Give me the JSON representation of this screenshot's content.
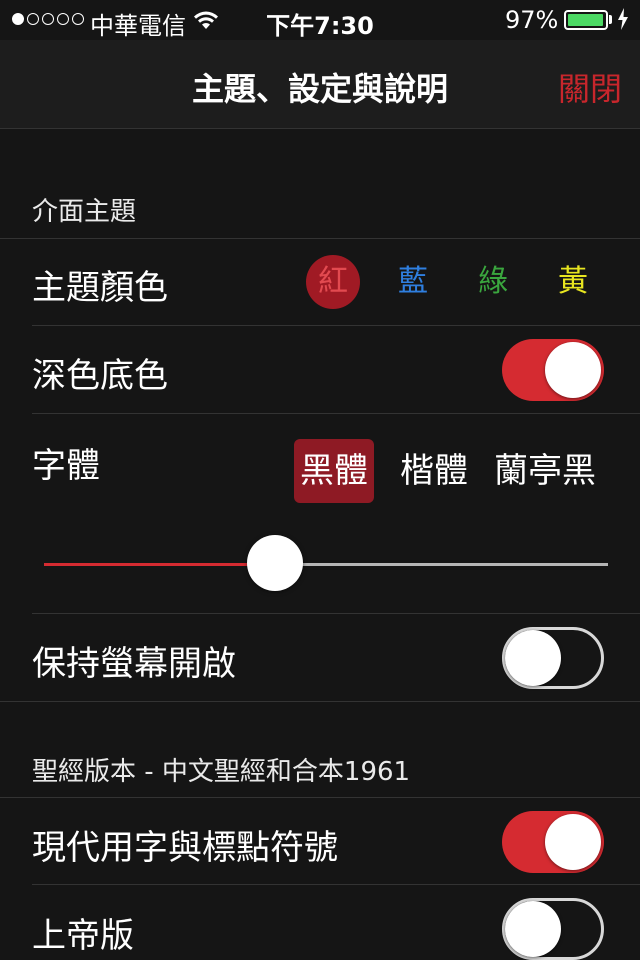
{
  "status_bar": {
    "carrier": "中華電信",
    "time": "下午7:30",
    "battery_percent": "97%",
    "battery_level": 0.97,
    "signal_strength": 1,
    "signal_max": 5
  },
  "nav": {
    "title": "主題、設定與說明",
    "close_label": "關閉"
  },
  "sections": {
    "interface_theme": "介面主題",
    "bible_version": "聖經版本 - 中文聖經和合本1961"
  },
  "theme_color": {
    "label": "主題顏色",
    "options": [
      {
        "label": "紅",
        "color": "#e24a50",
        "selected": true
      },
      {
        "label": "藍",
        "color": "#2f7fe0",
        "selected": false
      },
      {
        "label": "綠",
        "color": "#3aa63e",
        "selected": false
      },
      {
        "label": "黃",
        "color": "#e8e620",
        "selected": false
      }
    ]
  },
  "dark_background": {
    "label": "深色底色",
    "on": true
  },
  "font": {
    "label": "字體",
    "options": [
      {
        "label": "黑體",
        "selected": true
      },
      {
        "label": "楷體",
        "selected": false
      },
      {
        "label": "蘭亭黑",
        "selected": false
      }
    ],
    "size_level": 0.41
  },
  "keep_screen_on": {
    "label": "保持螢幕開啟",
    "on": false
  },
  "modern_text": {
    "label": "現代用字與標點符號",
    "on": true
  },
  "shangdi_version": {
    "label": "上帝版",
    "on": false
  },
  "colors": {
    "accent": "#d52b31",
    "background": "#151515",
    "navbar": "#1d1d1d"
  }
}
